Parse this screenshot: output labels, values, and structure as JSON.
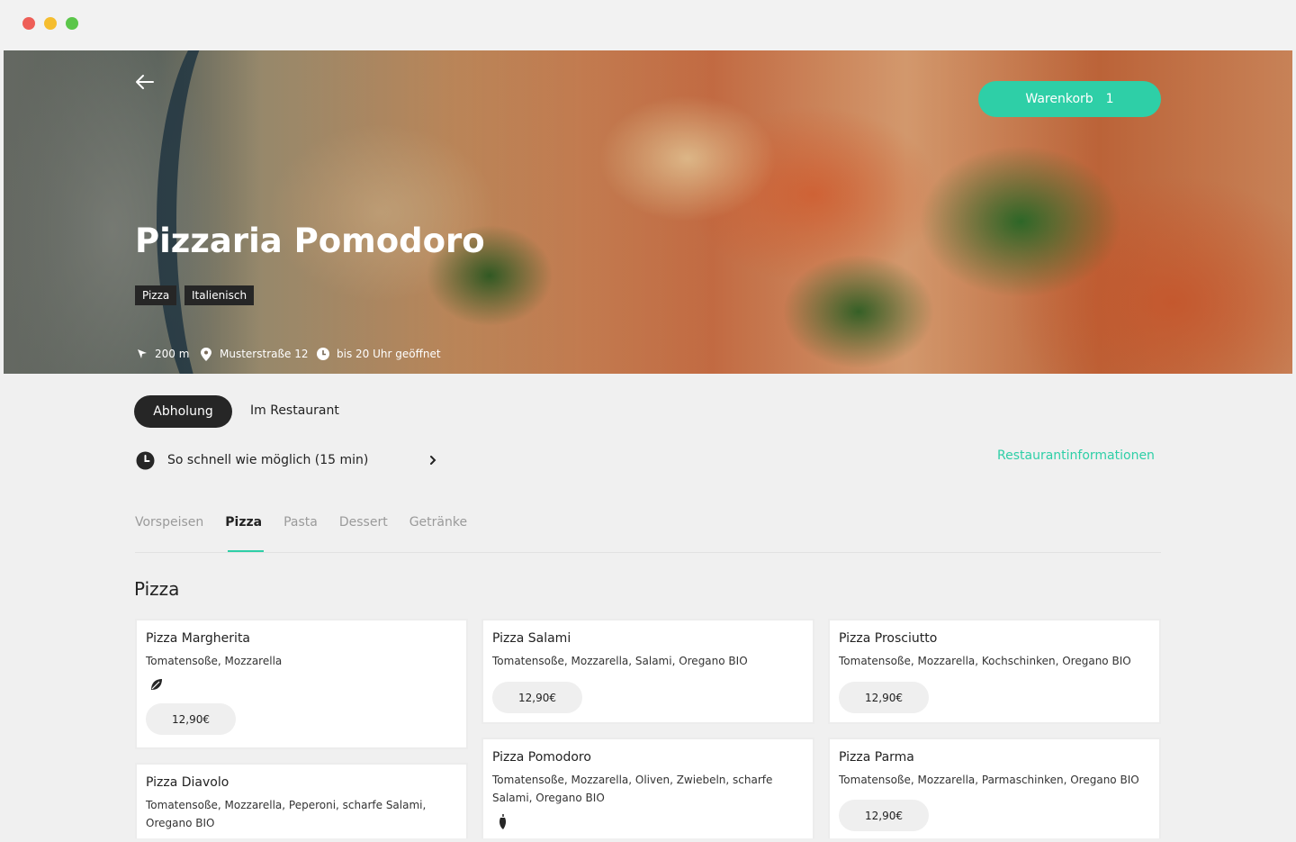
{
  "window": {
    "controls": [
      "close",
      "minimize",
      "maximize"
    ]
  },
  "hero": {
    "back_icon": "arrow-left-icon",
    "title": "Pizzaria Pomodoro",
    "tags": [
      "Pizza",
      "Italienisch"
    ],
    "cart": {
      "label": "Warenkorb",
      "count": "1"
    },
    "meta": {
      "distance": "200 m",
      "address": "Musterstraße 12",
      "hours": "bis 20 Uhr geöffnet"
    }
  },
  "order": {
    "modes": [
      "Abholung",
      "Im Restaurant"
    ],
    "active_mode": "Abholung",
    "time": "So schnell wie möglich (15 min)",
    "info_link": "Restaurantinformationen"
  },
  "categories": [
    "Vorspeisen",
    "Pizza",
    "Pasta",
    "Dessert",
    "Getränke"
  ],
  "active_category": "Pizza",
  "section_title": "Pizza",
  "menu": [
    {
      "name": "Pizza Margherita",
      "desc": "Tomatensoße, Mozzarella",
      "icon": "leaf-icon",
      "price": "12,90€"
    },
    {
      "name": "Pizza Salami",
      "desc": "Tomatensoße, Mozzarella, Salami, Oregano BIO",
      "icon": "",
      "price": "12,90€"
    },
    {
      "name": "Pizza Prosciutto",
      "desc": "Tomatensoße, Mozzarella, Kochschinken, Oregano BIO",
      "icon": "",
      "price": "12,90€"
    },
    {
      "name": "Pizza Diavolo",
      "desc": "Tomatensoße, Mozzarella, Peperoni, scharfe Salami, Oregano BIO",
      "icon": "",
      "price": ""
    },
    {
      "name": "Pizza Pomodoro",
      "desc": "Tomatensoße, Mozzarella, Oliven, Zwiebeln, scharfe Salami, Oregano BIO",
      "icon": "chili-icon",
      "price": ""
    },
    {
      "name": "Pizza Parma",
      "desc": "Tomatensoße, Mozzarella, Parmaschinken, Oregano BIO",
      "icon": "",
      "price": "12,90€"
    }
  ],
  "colors": {
    "accent": "#2ecfa7",
    "dark": "#262626"
  }
}
